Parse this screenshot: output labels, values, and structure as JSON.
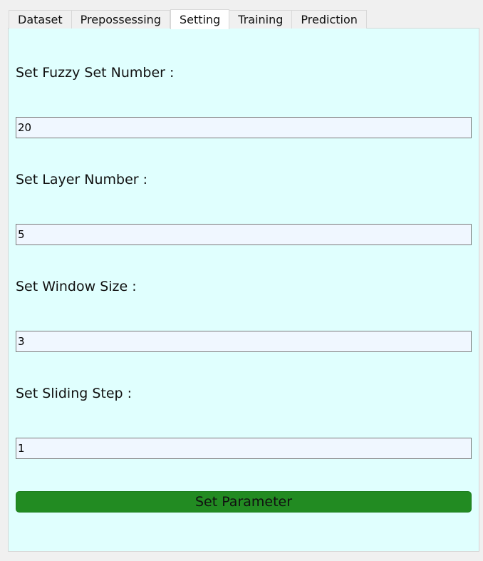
{
  "tabs": [
    {
      "label": "Dataset"
    },
    {
      "label": "Prepossessing"
    },
    {
      "label": "Setting"
    },
    {
      "label": "Training"
    },
    {
      "label": "Prediction"
    }
  ],
  "active_tab": "Setting",
  "settings": {
    "fuzzy_set_label": "Set Fuzzy Set Number :",
    "fuzzy_set_value": "20",
    "layer_label": "Set Layer Number :",
    "layer_value": "5",
    "window_label": "Set Window Size :",
    "window_value": "3",
    "sliding_label": "Set Sliding Step :",
    "sliding_value": "1"
  },
  "button": {
    "label": "Set Parameter",
    "color": "#228b22"
  },
  "colors": {
    "panel_background": "#e0fffe",
    "input_background": "#f0f7ff"
  }
}
